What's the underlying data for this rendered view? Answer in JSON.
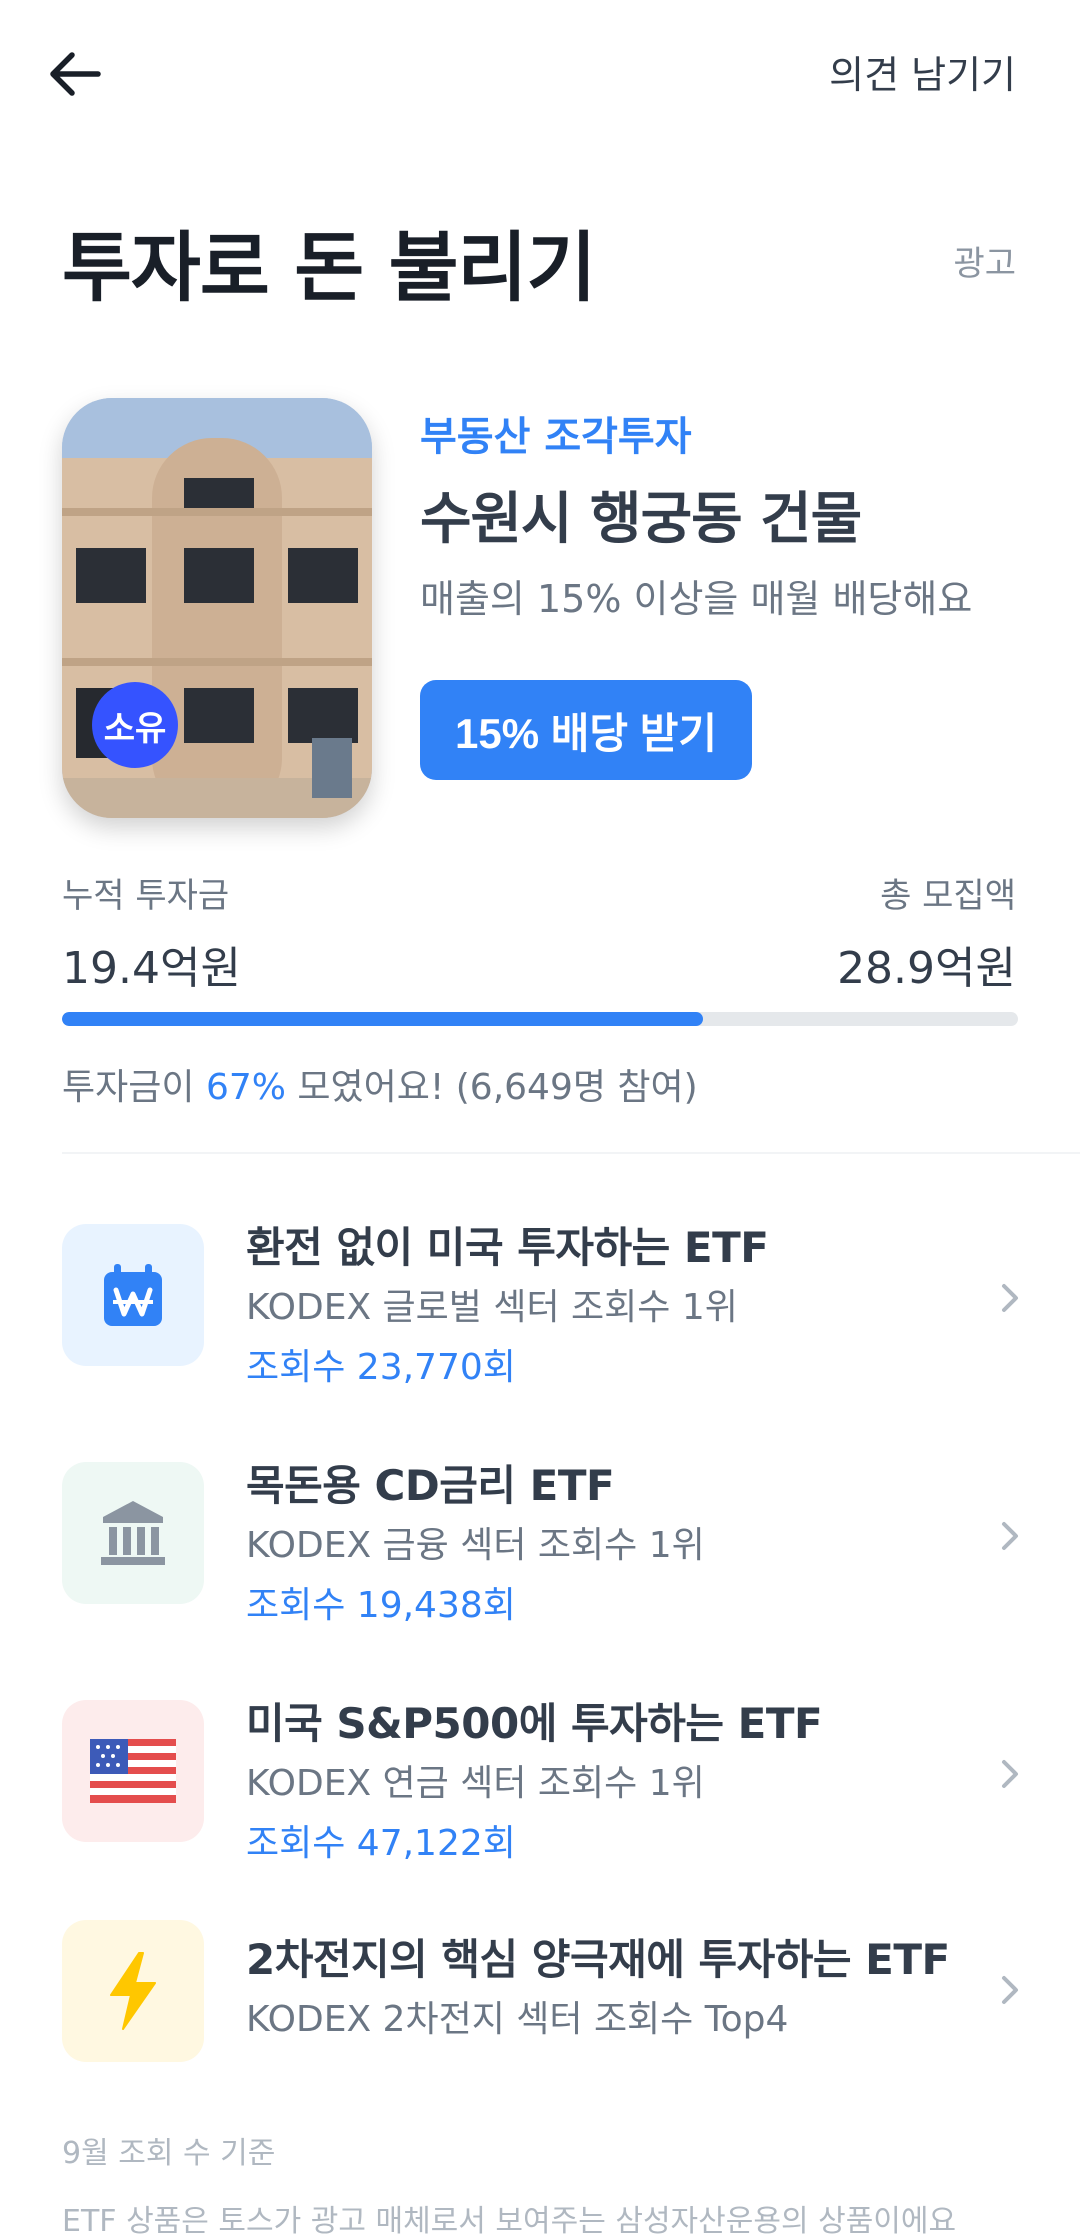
{
  "header": {
    "feedback_label": "의견 남기기"
  },
  "page_title": "투자로 돈 불리기",
  "ad_label": "광고",
  "promo": {
    "badge": "소유",
    "category": "부동산 조각투자",
    "name": "수원시 행궁동 건물",
    "description": "매출의 15% 이상을 매월 배당해요",
    "cta_label": "15% 배당 받기",
    "accumulated_label": "누적 투자금",
    "accumulated_value": "19.4억원",
    "target_label": "총 모집액",
    "target_value": "28.9억원",
    "progress_fraction": 0.67,
    "progress_prefix": "투자금이 ",
    "progress_percent": "67%",
    "progress_suffix": " 모였어요! (6,649명 참여)"
  },
  "items": [
    {
      "title": "환전 없이 미국 투자하는 ETF",
      "subtitle": "KODEX 글로벌 섹터 조회수 1위",
      "views": "조회수 23,770회",
      "icon": "won-calendar-icon",
      "bg": "#e8f3ff"
    },
    {
      "title": "목돈용 CD금리 ETF",
      "subtitle": "KODEX 금융 섹터 조회수 1위",
      "views": "조회수 19,438회",
      "icon": "bank-icon",
      "bg": "#eef8f4"
    },
    {
      "title": "미국 S&P500에 투자하는 ETF",
      "subtitle": "KODEX 연금 섹터 조회수 1위",
      "views": "조회수 47,122회",
      "icon": "us-flag-icon",
      "bg": "#fdecec"
    },
    {
      "title": "2차전지의 핵심 양극재에 투자하는 ETF",
      "subtitle": "KODEX 2차전지 섹터 조회수 Top4",
      "icon": "lightning-icon",
      "bg": "#fff8e1"
    }
  ],
  "footnote": "9월 조회 수 기준",
  "disclaimer": "ETF 상품은 토스가 광고 매체로서 보여주는 삼성자산운용의 상품이에요",
  "colors": {
    "accent": "#3182f6",
    "text_primary": "#191f28",
    "text_secondary": "#6b7684"
  }
}
